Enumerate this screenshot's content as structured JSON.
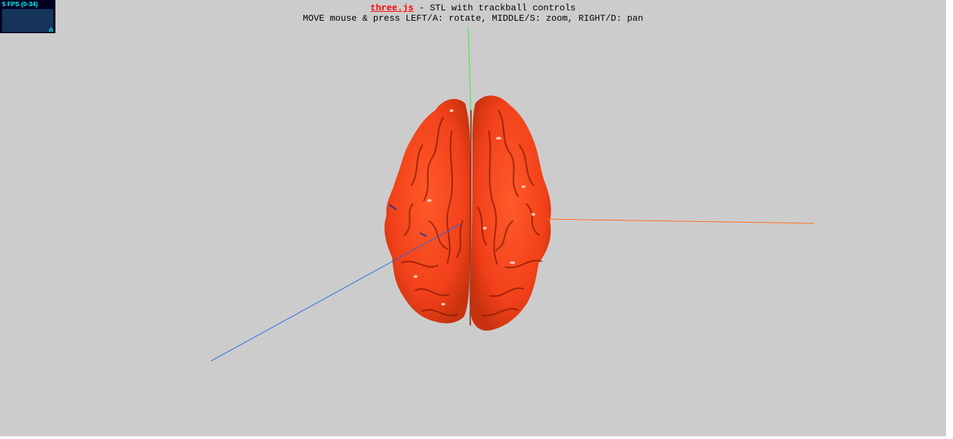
{
  "info": {
    "link_text": "three.js",
    "title_rest": " - STL with trackball controls",
    "instructions": "MOVE mouse & press LEFT/A: rotate, MIDDLE/S: zoom, RIGHT/D: pan"
  },
  "stats": {
    "fps_label": "5 FPS (0-34)"
  },
  "scene": {
    "background_color": "#cccccc",
    "model_color": "#ff4a1f",
    "axes": {
      "x_color": "#ff6a10",
      "y_color": "#33ee33",
      "z_color": "#2266ee"
    }
  }
}
